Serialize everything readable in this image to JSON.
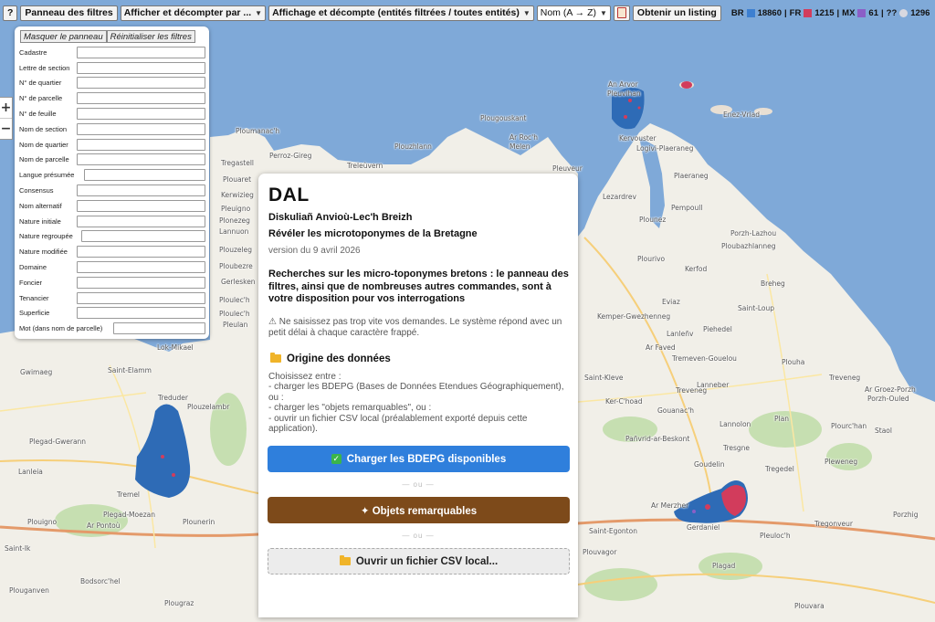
{
  "toolbar": {
    "help_label": "?",
    "filters_panel_label": "Panneau des filtres",
    "display_count_label": "Afficher et décompter par ...",
    "display_mode_value": "Affichage et décompte (entités filtrées / toutes entités)",
    "sort_value": "Nom (A → Z)",
    "get_listing_label": "Obtenir un listing",
    "stats": [
      {
        "code": "BR",
        "count": "18860",
        "color": "#3d7fd0"
      },
      {
        "code": "FR",
        "count": "1215",
        "color": "#d23c5c"
      },
      {
        "code": "MX",
        "count": "61",
        "color": "#8b5fc7"
      },
      {
        "code": "??",
        "count": "1296",
        "color": "#d8d8e0"
      }
    ]
  },
  "map": {
    "zoom_in": "+",
    "zoom_out": "−",
    "places": [
      "An Arvor",
      "Pleuvihan",
      "Kervouster",
      "Enez-Vriad",
      "Logivi-Plaeraneg",
      "Plougouskant",
      "Ar Roc'h",
      "Melen",
      "Treleùvern",
      "Plouzhlann",
      "Pleuveur",
      "Lezardrev",
      "Perroz-Gireg",
      "Tregastell",
      "Ploumanac'h",
      "Plaeraneg",
      "Pempoull",
      "Plounez",
      "Porzh-Lazhou",
      "Ploubazhlanneg",
      "Plourivo",
      "Kerfod",
      "Breheg",
      "Saint-Loup",
      "Kemper-Gwezhenneg",
      "Eviaz",
      "Piehedel",
      "Lanleñv",
      "Ar Faved",
      "Tremeven-Gouelou",
      "Plouha",
      "Saint-Kleve",
      "Treveneg",
      "Treveneg",
      "Lanneber",
      "Ker-C'hoad",
      "Ar Groez-Porzh",
      "Porzh-Ouled",
      "Gouanac'h",
      "Lannolon",
      "Plan",
      "Plourc'han",
      "Staol",
      "Pañvrid-ar-Beskont",
      "Tresgne",
      "Goudelin",
      "Tregedel",
      "Pleweneg",
      "Ar Merzher",
      "Gerdaniel",
      "Pleuloc'h",
      "Tregonveur",
      "Saint-Egonton",
      "Plouvagor",
      "Plagad",
      "Porzhig",
      "Plouvara",
      "Gwimaeg",
      "Saint-Elamm",
      "Treduder",
      "Ploulec'h",
      "Plegad-Gwerann",
      "Plouzelambr",
      "Lanleia",
      "Tremel",
      "Plegad-Moezan",
      "Plounerin",
      "Plouigno",
      "Ar Pontoù",
      "Bodsorc'hel",
      "Plouganven",
      "Plougraz",
      "Lok-Mikael",
      "Lannuon",
      "Saint-Ik",
      "Ploubezre",
      "Kerwizieg",
      "Pleuigno",
      "Plouzeleg",
      "Plouaret",
      "Gerlesken",
      "Pleulan",
      "Plonezeg",
      "Ploulec'h"
    ]
  },
  "filters": {
    "hide_panel_label": "Masquer le panneau",
    "reset_filters_label": "Réinitialiser les filtres",
    "fields": [
      "Cadastre",
      "Lettre de section",
      "N° de quartier",
      "N° de parcelle",
      "N° de feuille",
      "Nom de section",
      "Nom de quartier",
      "Nom de parcelle",
      "Langue présumée",
      "Consensus",
      "Nom alternatif",
      "Nature initiale",
      "Nature regroupée",
      "Nature modifiée",
      "Domaine",
      "Foncier",
      "Tenancier",
      "Superficie",
      "Mot (dans nom de parcelle)"
    ]
  },
  "dialog": {
    "title": "DAL",
    "subtitle": "Diskuliañ Anvioù-Lec'h Breizh",
    "tagline": "Révéler les microtoponymes de la Bretagne",
    "version": "version du 9 avril 2026",
    "lead": "Recherches sur les micro-toponymes bretons : le panneau des filtres, ainsi que de nombreuses autres commandes, sont à votre disposition pour vos interrogations",
    "warning": "⚠ Ne saisissez pas trop vite vos demandes. Le système répond avec un petit délai à chaque caractère frappé.",
    "section_heading": "Origine des données",
    "body_lines": [
      "Choisissez entre :",
      "- charger les BDEPG (Bases de Données Etendues Géographiquement), ou :",
      "- charger les \"objets remarquables\", ou :",
      "- ouvrir un fichier CSV local (préalablement exporté depuis cette application)."
    ],
    "load_bdepg_label": "Charger les BDEPG disponibles",
    "or_label": "— ou —",
    "remarkable_label": "✦ Objets remarquables",
    "open_csv_label": "Ouvrir un fichier CSV local...",
    "colors": {
      "blue": "#2f7fdc",
      "brown": "#7d4a1a",
      "grey": "#ececec"
    }
  }
}
